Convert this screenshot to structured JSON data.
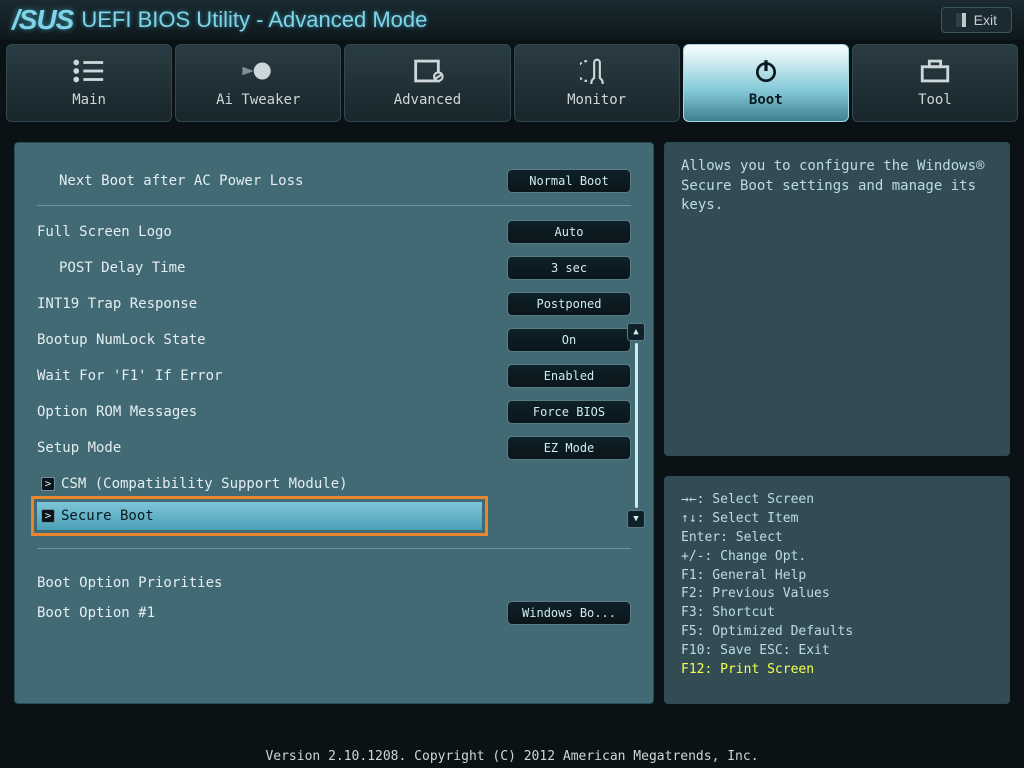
{
  "header": {
    "brand": "/SUS",
    "title": "UEFI BIOS Utility - Advanced Mode",
    "exit": "Exit"
  },
  "tabs": {
    "main": "Main",
    "tweaker": "Ai Tweaker",
    "advanced": "Advanced",
    "monitor": "Monitor",
    "boot": "Boot",
    "tool": "Tool"
  },
  "settings": {
    "nextBoot": {
      "label": "Next Boot after AC Power Loss",
      "value": "Normal Boot"
    },
    "fullScreenLogo": {
      "label": "Full Screen Logo",
      "value": "Auto"
    },
    "postDelay": {
      "label": "POST Delay Time",
      "value": "3 sec"
    },
    "int19": {
      "label": "INT19 Trap Response",
      "value": "Postponed"
    },
    "numlock": {
      "label": "Bootup NumLock State",
      "value": "On"
    },
    "waitF1": {
      "label": "Wait For 'F1' If Error",
      "value": "Enabled"
    },
    "optionRom": {
      "label": "Option ROM Messages",
      "value": "Force BIOS"
    },
    "setupMode": {
      "label": "Setup Mode",
      "value": "EZ Mode"
    },
    "csm": {
      "label": "CSM (Compatibility Support Module)"
    },
    "secureBoot": {
      "label": "Secure Boot"
    },
    "bootPrioTitle": "Boot Option Priorities",
    "bootOpt1": {
      "label": "Boot Option #1",
      "value": "Windows Bo..."
    }
  },
  "help": "Allows you to configure the Windows® Secure Boot settings and manage its keys.",
  "keys": {
    "l1": "→←: Select Screen",
    "l2": "↑↓: Select Item",
    "l3": "Enter: Select",
    "l4": "+/-: Change Opt.",
    "l5": "F1: General Help",
    "l6": "F2: Previous Values",
    "l7": "F3: Shortcut",
    "l8": "F5: Optimized Defaults",
    "l9": "F10: Save  ESC: Exit",
    "l10": "F12: Print Screen"
  },
  "footer": "Version 2.10.1208. Copyright (C) 2012 American Megatrends, Inc."
}
